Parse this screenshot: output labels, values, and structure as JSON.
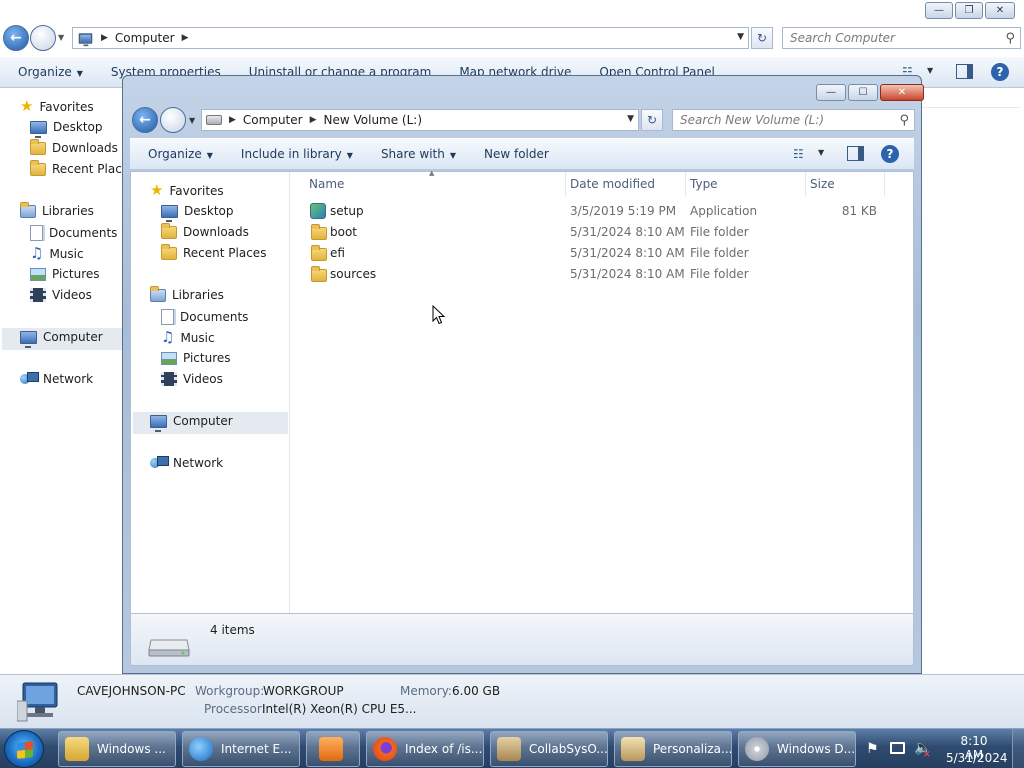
{
  "bg_window": {
    "breadcrumb": [
      "Computer"
    ],
    "search_placeholder": "Search Computer",
    "toolbar": [
      "Organize",
      "System properties",
      "Uninstall or change a program",
      "Map network drive",
      "Open Control Panel"
    ],
    "nav": {
      "favorites": "Favorites",
      "fav_items": [
        "Desktop",
        "Downloads",
        "Recent Places"
      ],
      "libraries": "Libraries",
      "lib_items": [
        "Documents",
        "Music",
        "Pictures",
        "Videos"
      ],
      "computer": "Computer",
      "network": "Network"
    }
  },
  "front_window": {
    "breadcrumb": [
      "Computer",
      "New Volume (L:)"
    ],
    "search_placeholder": "Search New Volume (L:)",
    "toolbar": {
      "organize": "Organize",
      "include_in_library": "Include in library",
      "share_with": "Share with",
      "new_folder": "New folder"
    },
    "nav": {
      "favorites": "Favorites",
      "fav_items": [
        "Desktop",
        "Downloads",
        "Recent Places"
      ],
      "libraries": "Libraries",
      "lib_items": [
        "Documents",
        "Music",
        "Pictures",
        "Videos"
      ],
      "computer": "Computer",
      "network": "Network"
    },
    "columns": {
      "name": "Name",
      "date": "Date modified",
      "type": "Type",
      "size": "Size"
    },
    "files": [
      {
        "name": "setup",
        "date": "3/5/2019 5:19 PM",
        "type": "Application",
        "size": "81 KB",
        "icon": "setup-app-icon"
      },
      {
        "name": "boot",
        "date": "5/31/2024 8:10 AM",
        "type": "File folder",
        "size": "",
        "icon": "folder-icon"
      },
      {
        "name": "efi",
        "date": "5/31/2024 8:10 AM",
        "type": "File folder",
        "size": "",
        "icon": "folder-icon"
      },
      {
        "name": "sources",
        "date": "5/31/2024 8:10 AM",
        "type": "File folder",
        "size": "",
        "icon": "folder-icon"
      }
    ],
    "status": "4 items"
  },
  "details": {
    "pc_name": "CAVEJOHNSON-PC",
    "workgroup_label": "Workgroup:",
    "workgroup": "WORKGROUP",
    "memory_label": "Memory:",
    "memory": "6.00 GB",
    "processor_label": "Processor:",
    "processor": "Intel(R) Xeon(R) CPU E5..."
  },
  "taskbar": {
    "items": [
      {
        "label": "Windows ...",
        "color": "#e9c35a"
      },
      {
        "label": "Internet E...",
        "color": "#3b8fd8"
      },
      {
        "label": "",
        "color": "#f08a24"
      },
      {
        "label": "Index of /is...",
        "color": "#e8642c"
      },
      {
        "label": "CollabSysO...",
        "color": "#c9a46a"
      },
      {
        "label": "Personaliza...",
        "color": "#d8c08a"
      },
      {
        "label": "Windows D...",
        "color": "#c9ced6"
      }
    ],
    "time": "8:10 AM",
    "date": "5/31/2024"
  },
  "colors": {
    "accent": "#1e5aa8",
    "selection": "#e5eaf1",
    "taskbar": "#2f4b70"
  }
}
